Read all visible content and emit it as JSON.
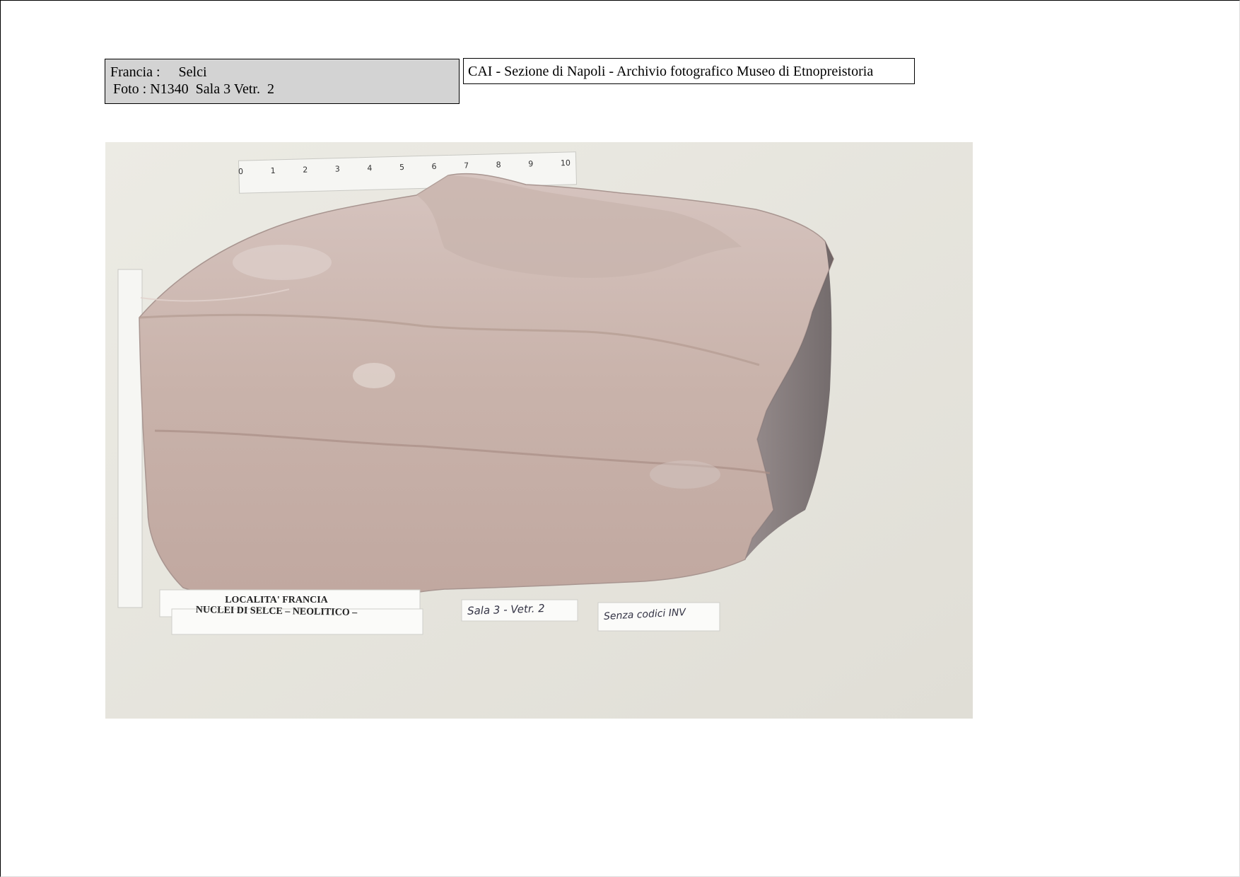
{
  "header": {
    "country_label": "Francia :",
    "category": "Selci",
    "photo_line": "Foto : N1340  Sala 3 Vetr.  2",
    "archive_title": "CAI - Sezione di Napoli  - Archivio fotografico Museo di Etnopreistoria"
  },
  "photo": {
    "ruler_ticks": [
      "0",
      "1",
      "2",
      "3",
      "4",
      "5",
      "6",
      "7",
      "8",
      "9",
      "10"
    ],
    "label_line1": "LOCALITA' FRANCIA",
    "label_line2": "NUCLEI DI SELCE – NEOLITICO –",
    "hand_label_room": "Sala 3 - Vetr. 2",
    "hand_label_code": "Senza codici INV"
  }
}
